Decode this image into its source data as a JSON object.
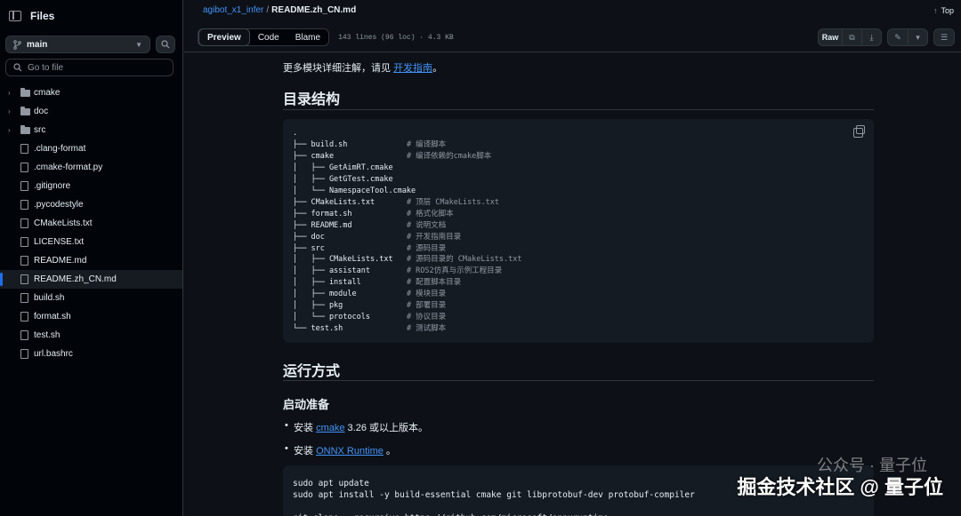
{
  "sidebar": {
    "title": "Files",
    "branch": "main",
    "goto_placeholder": "Go to file",
    "items": [
      {
        "label": "cmake",
        "type": "folder"
      },
      {
        "label": "doc",
        "type": "folder"
      },
      {
        "label": "src",
        "type": "folder"
      },
      {
        "label": ".clang-format",
        "type": "file"
      },
      {
        "label": ".cmake-format.py",
        "type": "file"
      },
      {
        "label": ".gitignore",
        "type": "file"
      },
      {
        "label": ".pycodestyle",
        "type": "file"
      },
      {
        "label": "CMakeLists.txt",
        "type": "file"
      },
      {
        "label": "LICENSE.txt",
        "type": "file"
      },
      {
        "label": "README.md",
        "type": "file"
      },
      {
        "label": "README.zh_CN.md",
        "type": "file",
        "active": true
      },
      {
        "label": "build.sh",
        "type": "file"
      },
      {
        "label": "format.sh",
        "type": "file"
      },
      {
        "label": "test.sh",
        "type": "file"
      },
      {
        "label": "url.bashrc",
        "type": "file"
      }
    ]
  },
  "header": {
    "repo": "agibot_x1_infer",
    "separator": "/",
    "file": "README.zh_CN.md",
    "top_label": "Top"
  },
  "filebar": {
    "tabs": [
      "Preview",
      "Code",
      "Blame"
    ],
    "meta": "143 lines (96 loc) · 4.3 KB",
    "raw_label": "Raw"
  },
  "content": {
    "intro_text": "更多模块详细注解，请见 ",
    "intro_link": "开发指南",
    "intro_end": "。",
    "h2_structure": "目录结构",
    "tree_code": [
      {
        "code": ".",
        "comment": ""
      },
      {
        "code": "├── build.sh             ",
        "comment": "# 编译脚本"
      },
      {
        "code": "├── cmake                ",
        "comment": "# 编译依赖的cmake脚本"
      },
      {
        "code": "│   ├── GetAimRT.cmake",
        "comment": ""
      },
      {
        "code": "│   ├── GetGTest.cmake",
        "comment": ""
      },
      {
        "code": "│   └── NamespaceTool.cmake",
        "comment": ""
      },
      {
        "code": "├── CMakeLists.txt       ",
        "comment": "# 顶层 CMakeLists.txt"
      },
      {
        "code": "├── format.sh            ",
        "comment": "# 格式化脚本"
      },
      {
        "code": "├── README.md            ",
        "comment": "# 说明文档"
      },
      {
        "code": "├── doc                  ",
        "comment": "# 开发指南目录"
      },
      {
        "code": "├── src                  ",
        "comment": "# 源码目录"
      },
      {
        "code": "│   ├── CMakeLists.txt   ",
        "comment": "# 源码目录的 CMakeLists.txt"
      },
      {
        "code": "│   ├── assistant        ",
        "comment": "# ROS2仿真与示例工程目录"
      },
      {
        "code": "│   ├── install          ",
        "comment": "# 配置脚本目录"
      },
      {
        "code": "│   ├── module           ",
        "comment": "# 模块目录"
      },
      {
        "code": "│   ├── pkg              ",
        "comment": "# 部署目录"
      },
      {
        "code": "│   └── protocols        ",
        "comment": "# 协议目录"
      },
      {
        "code": "└── test.sh              ",
        "comment": "# 测试脚本"
      }
    ],
    "h2_run": "运行方式",
    "h3_prep": "启动准备",
    "bullet1_pre": "安装 ",
    "bullet1_link": "cmake",
    "bullet1_post": " 3.26 或以上版本。",
    "bullet2_pre": "安装 ",
    "bullet2_link": "ONNX Runtime",
    "bullet2_post": " 。",
    "install_code": [
      "sudo apt update",
      "sudo apt install -y build-essential cmake git libprotobuf-dev protobuf-compiler",
      "",
      "git clone --recursive https://github.com/microsoft/onnxruntime"
    ]
  },
  "watermark": {
    "line1": "公众号 · 量子位",
    "line2": "掘金技术社区 @ 量子位"
  }
}
